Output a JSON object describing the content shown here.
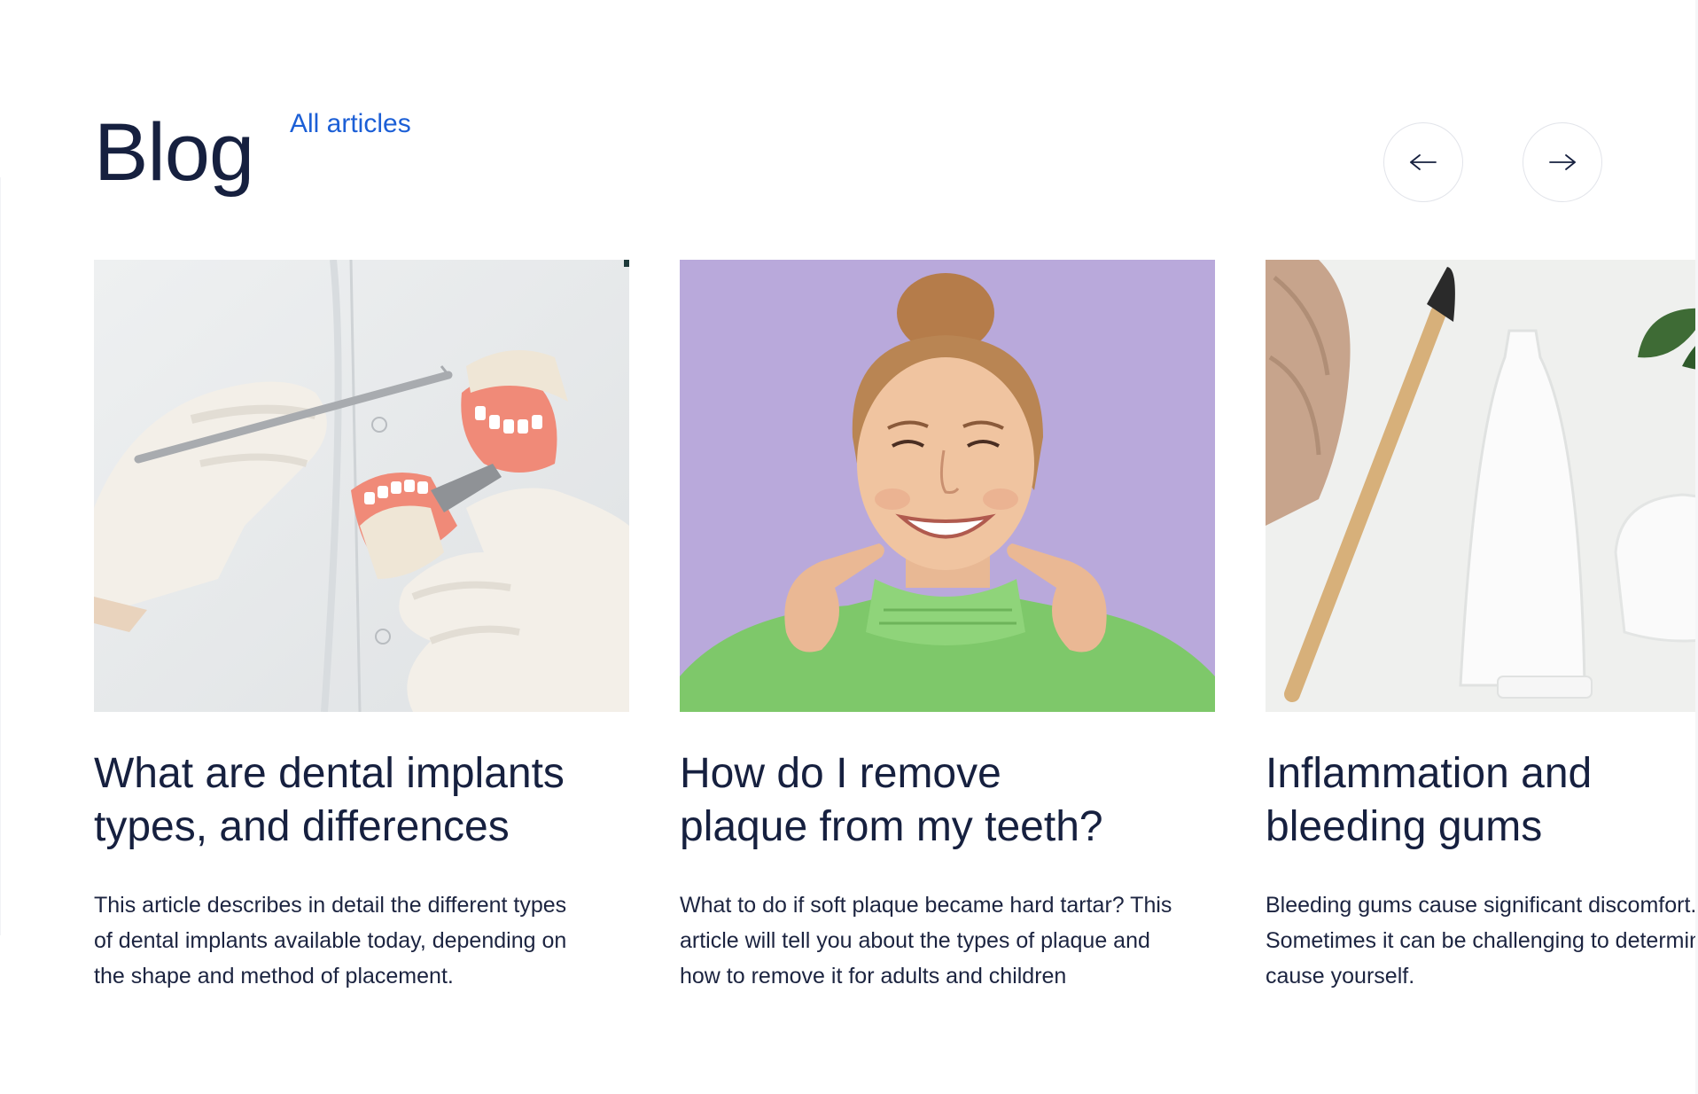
{
  "section": {
    "title": "Blog",
    "all_articles_label": "All articles"
  },
  "navigation": {
    "prev_icon": "arrow-left-icon",
    "next_icon": "arrow-right-icon"
  },
  "articles": [
    {
      "image": "dentist-holding-denture-model",
      "title_lines": [
        "What are dental implants",
        "types, and differences"
      ],
      "description_lines": [
        "This article describes in detail the different types",
        "of dental implants available today, depending on",
        "the shape and method of placement."
      ]
    },
    {
      "image": "smiling-woman-pointing-at-teeth",
      "title_lines": [
        "How do I remove",
        "plaque from my teeth?"
      ],
      "description_lines": [
        "What to do if soft plaque became hard tartar? This",
        "article will tell you about the types of plaque and",
        "how to remove it for adults and children"
      ]
    },
    {
      "image": "bamboo-toothbrush-and-toothpaste",
      "title_lines": [
        "Inflammation and",
        "bleeding gums"
      ],
      "description_lines": [
        "Bleeding gums cause significant discomfort.",
        "Sometimes it can be challenging to determine the",
        "cause yourself."
      ]
    }
  ],
  "colors": {
    "heading": "#16203f",
    "link": "#1c5fd6",
    "button_border": "#e2e4ea",
    "card2_background": "#b9a9db"
  }
}
